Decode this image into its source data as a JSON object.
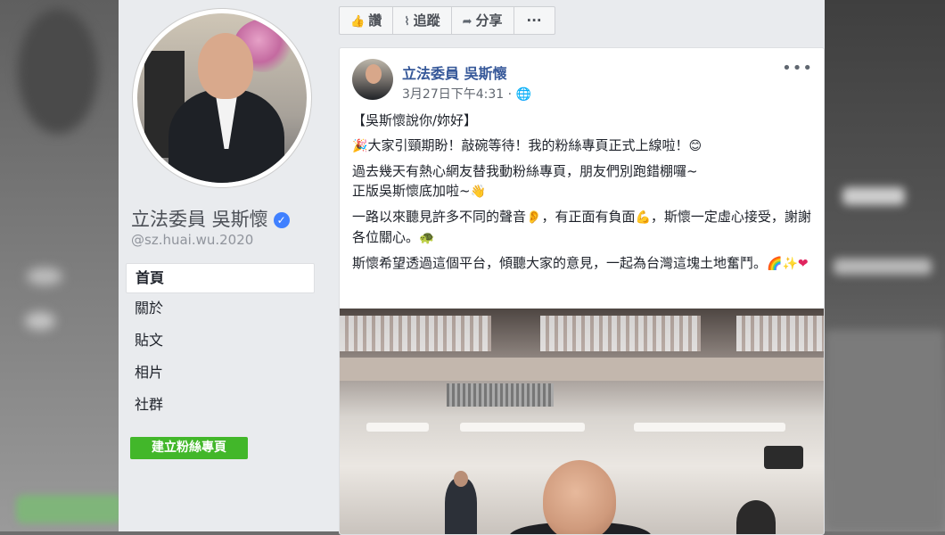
{
  "page": {
    "name": "立法委員 吳斯懷",
    "handle": "@sz.huai.wu.2020",
    "verified": true
  },
  "sidebar": {
    "items": [
      {
        "label": "首頁",
        "active": true
      },
      {
        "label": "關於",
        "active": false
      },
      {
        "label": "貼文",
        "active": false
      },
      {
        "label": "相片",
        "active": false
      },
      {
        "label": "社群",
        "active": false
      }
    ],
    "create_button": "建立粉絲專頁"
  },
  "actions": {
    "like": "讚",
    "follow": "追蹤",
    "share": "分享",
    "more": "···"
  },
  "post": {
    "author": "立法委員 吳斯懷",
    "timestamp": "3月27日下午4:31 ·",
    "paragraphs": [
      "【吳斯懷說你/妳好】",
      "大家引頸期盼！敲碗等待！我的粉絲專頁正式上線啦！",
      "過去幾天有熱心網友替我動粉絲專頁，朋友們別跑錯棚囉~",
      "正版吳斯懷底加啦~",
      "一路以來聽見許多不同的聲音",
      "，有正面有負面",
      "，斯懷一定虛心接受，謝謝各位關心。",
      "斯懷希望透過這個平台，傾聽大家的意見，一起為台灣這塊土地奮鬥。"
    ]
  },
  "colors": {
    "link": "#365899",
    "green_button": "#42b72a",
    "verified_badge": "#4080ff",
    "page_bg": "#e9ebee"
  }
}
